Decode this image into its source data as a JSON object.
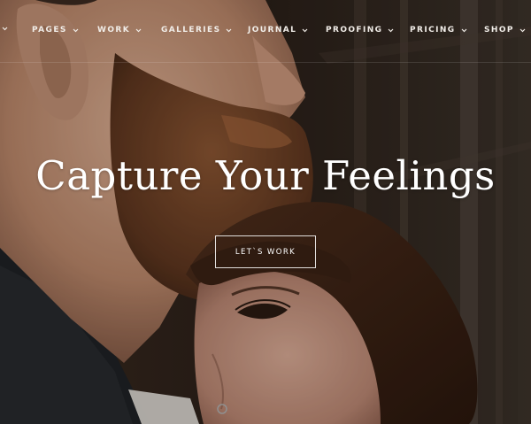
{
  "nav": {
    "items": [
      {
        "label": ""
      },
      {
        "label": "PAGES"
      },
      {
        "label": "WORK"
      },
      {
        "label": "GALLERIES"
      },
      {
        "label": "JOURNAL"
      },
      {
        "label": "PROOFING"
      },
      {
        "label": "PRICING"
      },
      {
        "label": "SHOP"
      }
    ],
    "chevron_icon": "chevron-down-icon"
  },
  "hero": {
    "title": "Capture Your Feelings",
    "cta_label": "LET`S WORK"
  },
  "colors": {
    "text": "#ffffff",
    "background_dark": "#1b1612",
    "skin": "#c69a80",
    "beard": "#6e4226",
    "hair": "#3e2416"
  }
}
